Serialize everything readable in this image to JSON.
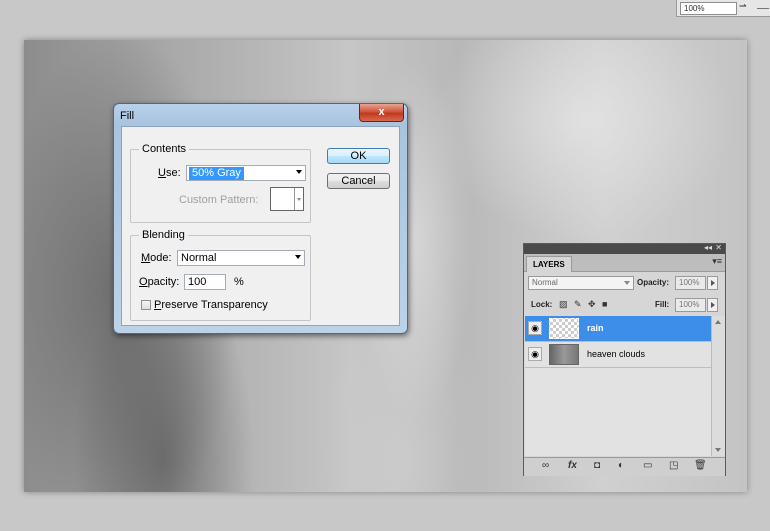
{
  "zoom": {
    "value": "100%"
  },
  "fill_dialog": {
    "title": "Fill",
    "close_glyph": "x",
    "contents": {
      "legend": "Contents",
      "use_label": "Use:",
      "use_value": "50% Gray",
      "custom_pattern_label": "Custom Pattern:"
    },
    "blending": {
      "legend": "Blending",
      "mode_label": "Mode:",
      "mode_value": "Normal",
      "opacity_label": "Opacity:",
      "opacity_value": "100",
      "percent": "%",
      "preserve_label": "Preserve Transparency",
      "preserve_checked": false
    },
    "ok_label": "OK",
    "cancel_label": "Cancel"
  },
  "layers_panel": {
    "tab": "LAYERS",
    "blend_mode": "Normal",
    "opacity_label": "Opacity:",
    "opacity_value": "100%",
    "lock_label": "Lock:",
    "fill_label": "Fill:",
    "fill_value": "100%",
    "layers": [
      {
        "name": "rain",
        "selected": true,
        "visible": true
      },
      {
        "name": "heaven clouds",
        "selected": false,
        "visible": true
      }
    ],
    "footer_icons": [
      "link-icon",
      "fx-icon",
      "mask-icon",
      "adjustment-icon",
      "group-icon",
      "new-layer-icon",
      "trash-icon"
    ]
  },
  "colors": {
    "selection": "#3399ff",
    "layer_selected": "#3d8ee8",
    "close_button": "#c0391e"
  }
}
